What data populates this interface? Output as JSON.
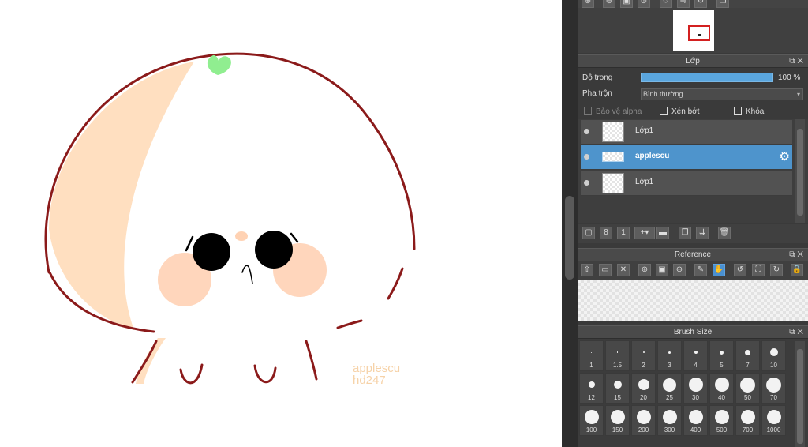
{
  "canvas": {
    "watermark_line1": "applescu",
    "watermark_line2": "hd247"
  },
  "navigator": {
    "toolbar_icons": [
      "zoom-in-icon",
      "zoom-out-icon",
      "fit-icon",
      "zoom-reset-icon",
      "rotate-left-icon",
      "flip-icon",
      "rotate-right-icon",
      "copy-icon"
    ]
  },
  "layer_panel": {
    "title": "Lớp",
    "opacity_label": "Độ trong",
    "opacity_value": "100 %",
    "opacity_percent": 100,
    "blend_label": "Pha trộn",
    "blend_value": "Bình thường",
    "protect_alpha": "Bảo vệ alpha",
    "clipping": "Xén bớt",
    "lock": "Khóa",
    "layers": [
      {
        "name": "Lớp1",
        "visible": true,
        "selected": false
      },
      {
        "name": "applescu",
        "visible": true,
        "selected": true
      },
      {
        "name": "Lớp1",
        "visible": true,
        "selected": false
      }
    ],
    "toolbar_icons": [
      "new-layer-icon",
      "new-layer-8bit-icon",
      "new-layer-1bit-icon",
      "add-layer-menu-icon",
      "folder-icon",
      "duplicate-icon",
      "merge-icon",
      "delete-icon"
    ]
  },
  "reference_panel": {
    "title": "Reference",
    "toolbar_icons": [
      "upload-icon",
      "open-folder-icon",
      "close-icon",
      "zoom-in-icon",
      "zoom-out-icon",
      "fit-icon",
      "eyedropper-icon",
      "hand-icon",
      "rotate-left-icon",
      "fit-screen-icon",
      "rotate-right-icon",
      "lock-icon"
    ]
  },
  "brush_panel": {
    "title": "Brush Size",
    "sizes": [
      "1",
      "1.5",
      "2",
      "3",
      "4",
      "5",
      "7",
      "10",
      "12",
      "15",
      "20",
      "25",
      "30",
      "40",
      "50",
      "70",
      "100",
      "150",
      "200",
      "300",
      "400",
      "500",
      "700",
      "1000"
    ]
  },
  "colors": {
    "selected_layer": "#4e94cc",
    "accent": "#5aa6de",
    "panel_bg": "#3a3a3a",
    "outline": "#8b1a1a",
    "leaf": "#90ee90",
    "peach": "#ffdab9"
  }
}
